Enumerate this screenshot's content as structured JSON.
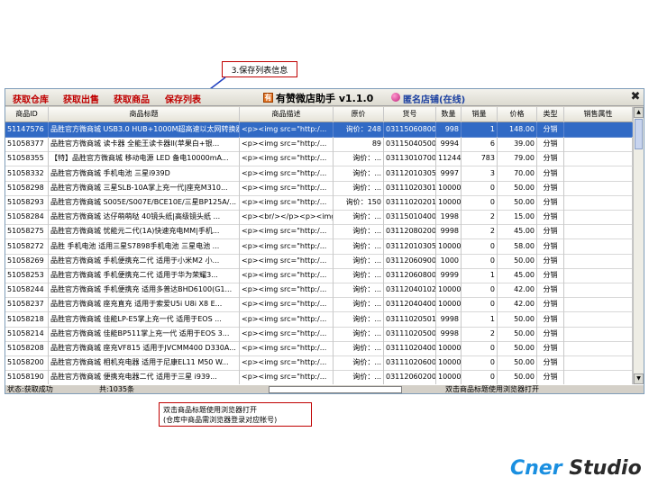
{
  "annotations": {
    "top": "3.保存列表信息",
    "bottom_line1": "双击商品标题使用浏览器打开",
    "bottom_line2": "(仓库中商品需浏览器登录对应帐号)"
  },
  "toolbar": {
    "buttons": [
      "获取仓库",
      "获取出售",
      "获取商品",
      "保存列表"
    ],
    "logo_glyph": "有",
    "title": "有赞微店助手 v1.1.0",
    "shop_status": "匿名店铺(在线)",
    "close_glyph": "✖"
  },
  "table": {
    "headers": [
      "商品ID",
      "商品标题",
      "商品描述",
      "原价",
      "货号",
      "数量",
      "销量",
      "价格",
      "类型",
      "销售属性"
    ],
    "rows": [
      [
        "51147576",
        "品胜官方微商城 USB3.0 HUB+1000M超高速以太网转换器",
        "<p><img src=\"http:/...",
        "询价：248",
        "031150608004",
        "998",
        "1",
        "148.00",
        "分销",
        ""
      ],
      [
        "51058377",
        "品胜官方微商城 读卡器 全能王读卡器II(苹果白+银...",
        "<p><img src=\"http:/...",
        "89",
        "031150405009",
        "9994",
        "6",
        "39.00",
        "分销",
        ""
      ],
      [
        "51058355",
        "【特】品胜官方微商城  移动电源 LED 备电10000mA...",
        "<p><img src=\"http:/...",
        "询价：...",
        "031130107001",
        "11244",
        "783",
        "79.00",
        "分销",
        ""
      ],
      [
        "51058332",
        "品胜官方微商城  手机电池 三星i939D",
        "<p><img src=\"http:/...",
        "询价：...",
        "031120103054",
        "9997",
        "3",
        "70.00",
        "分销",
        ""
      ],
      [
        "51058298",
        "品胜官方微商城  三星SLB-10A掌上充一代|座充M310...",
        "<p><img src=\"http:/...",
        "询价：...",
        "031110203016",
        "10000",
        "0",
        "50.00",
        "分销",
        ""
      ],
      [
        "51058293",
        "品胜官方微商城  S005E/S007E/BCE10E/三星BP125A/...",
        "<p><img src=\"http:/...",
        "询价：150",
        "031110202018",
        "10000",
        "0",
        "50.00",
        "分销",
        ""
      ],
      [
        "51058284",
        "品胜官方微商城 达仔萌萌哒 40镜头纸|高级镜头纸 ...",
        "<p><br/></p><p><img ...",
        "询价：...",
        "031150104001",
        "1998",
        "2",
        "15.00",
        "分销",
        ""
      ],
      [
        "51058275",
        "品胜官方微商城  忧能元二代(1A)快速充电MM|手机...",
        "<p><img src=\"http:/...",
        "询价：...",
        "031120802008",
        "9998",
        "2",
        "45.00",
        "分销",
        ""
      ],
      [
        "51058272",
        "品胜 手机电池 适用三星S7898手机电池 三星电池 ...",
        "<p><img src=\"http:/...",
        "询价：...",
        "031120103059",
        "10000",
        "0",
        "58.00",
        "分销",
        ""
      ],
      [
        "51058269",
        "品胜官方微商城  手机便携充二代 适用于小米M2 小...",
        "<p><img src=\"http:/...",
        "询价：...",
        "031120609001",
        "1000",
        "0",
        "50.00",
        "分销",
        ""
      ],
      [
        "51058253",
        "品胜官方微商城  手机便携充二代 适用于华为荣耀3...",
        "<p><img src=\"http:/...",
        "询价：...",
        "031120608005",
        "9999",
        "1",
        "45.00",
        "分销",
        ""
      ],
      [
        "51058244",
        "品胜官方微商城 手机便携充 适用多普达BHD6100(G1...",
        "<p><img src=\"http:/...",
        "询价：...",
        "031120401029",
        "10000",
        "0",
        "42.00",
        "分销",
        ""
      ],
      [
        "51058237",
        "品胜官方微商城  座充直充 适用于索爱U5i U8i X8 E...",
        "<p><img src=\"http:/...",
        "询价：...",
        "031120404006",
        "10000",
        "0",
        "42.00",
        "分销",
        ""
      ],
      [
        "51058218",
        "品胜官方微商城  佳能LP-E5掌上充一代 适用于EOS ...",
        "<p><img src=\"http:/...",
        "询价：...",
        "031110205011",
        "9998",
        "1",
        "50.00",
        "分销",
        ""
      ],
      [
        "51058214",
        "品胜官方微商城 佳能BP511掌上充一代 适用于EOS 3...",
        "<p><img src=\"http:/...",
        "询价：...",
        "031110205005",
        "9998",
        "2",
        "50.00",
        "分销",
        ""
      ],
      [
        "51058208",
        "品胜官方微商城  座充VF815 适用于JVCMM400 D330A...",
        "<p><img src=\"http:/...",
        "询价：...",
        "031110204007",
        "10000",
        "0",
        "50.00",
        "分销",
        ""
      ],
      [
        "51058200",
        "品胜官方微商城 相机充电器 适用于尼康EL11 M50 W...",
        "<p><img src=\"http:/...",
        "询价：...",
        "031110206009",
        "10000",
        "0",
        "50.00",
        "分销",
        ""
      ],
      [
        "51058190",
        "品胜官方微商城 便携充电器二代 适用于三星 i939...",
        "<p><img src=\"http:/...",
        "询价：...",
        "031120602004",
        "10000",
        "0",
        "50.00",
        "分销",
        ""
      ]
    ]
  },
  "statusbar": {
    "status": "状态:获取成功",
    "total": "共:1035条",
    "hint": "双击商品标题使用浏览器打开"
  },
  "brand": {
    "part1": "Cner",
    "part2": "Studio"
  },
  "colors": {
    "menu_red": "#c00000",
    "selection_blue": "#316ac5",
    "brand_blue": "#1a8fe0"
  }
}
